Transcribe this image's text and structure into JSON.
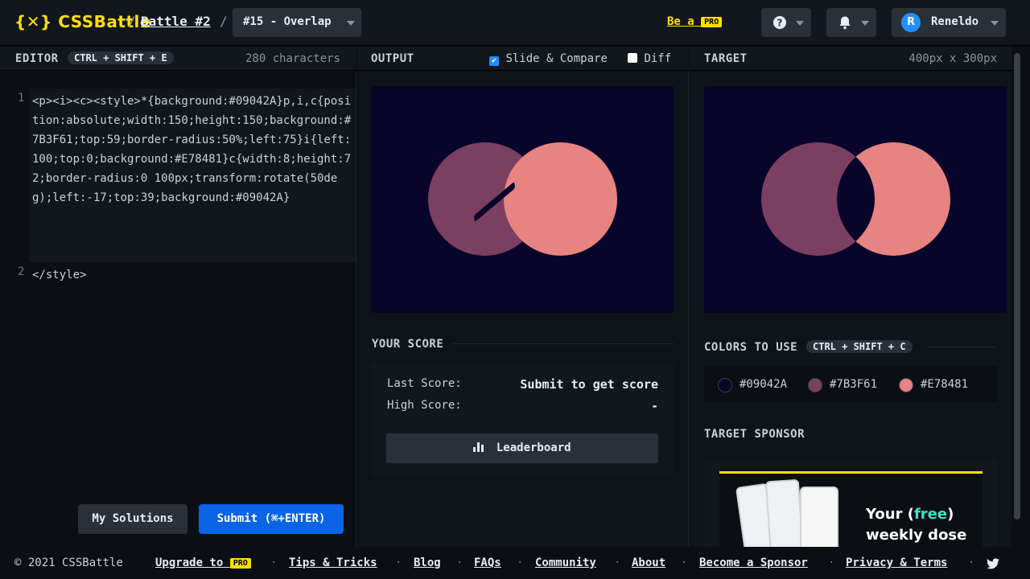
{
  "header": {
    "logo": "{✕} CSSBattle",
    "breadcrumb_battle": "Battle #2",
    "level": "#15 - Overlap",
    "be_a": "Be a",
    "pro": "PRO",
    "user": "Reneldo",
    "avatar_letter": "R",
    "help_icon": "?",
    "bell_icon": "bell-icon"
  },
  "editor": {
    "title": "EDITOR",
    "shortcut": "CTRL + SHIFT + E",
    "char_count": "280 characters",
    "line1": "1",
    "line2": "2",
    "code_line1": "<p><i><c><style>*{background:#09042A}p,i,c{position:absolute;width:150;height:150;background:#7B3F61;top:59;border-radius:50%;left:75}i{left:100;top:0;background:#E78481}c{width:8;height:72;border-radius:0 100px;transform:rotate(50deg);left:-17;top:39;background:#09042A}",
    "code_line2": "</style>",
    "my_solutions": "My Solutions",
    "submit": "Submit (⌘+ENTER)"
  },
  "output": {
    "title": "OUTPUT",
    "slide_compare": "Slide & Compare",
    "slide_checked": true,
    "diff": "Diff",
    "diff_checked": false,
    "your_score": "YOUR SCORE",
    "last_score_label": "Last Score:",
    "last_score_value": "Submit to get score",
    "high_score_label": "High Score:",
    "high_score_value": "-",
    "leaderboard": "Leaderboard"
  },
  "target": {
    "title": "TARGET",
    "size": "400px x 300px",
    "colors_title": "COLORS TO USE",
    "colors_shortcut": "CTRL + SHIFT + C",
    "colors": [
      {
        "hex": "#09042A",
        "label": "#09042A"
      },
      {
        "hex": "#7B3F61",
        "label": "#7B3F61"
      },
      {
        "hex": "#E78481",
        "label": "#E78481"
      }
    ],
    "sponsor_title": "TARGET SPONSOR",
    "ad_line1_a": "Your (",
    "ad_line1_free": "free",
    "ad_line1_b": ")",
    "ad_line2": "weekly dose"
  },
  "footer": {
    "copyright": "© 2021 CSSBattle",
    "links": [
      "Upgrade to",
      "Tips & Tricks",
      "Blog",
      "FAQs",
      "Community",
      "About",
      "Become a Sponsor",
      "Privacy & Terms"
    ],
    "pro": "PRO",
    "twitter_icon": "twitter-icon"
  },
  "colors": {
    "bg": "#09042A",
    "purple": "#7B3F61",
    "pink": "#E78481",
    "accent_yellow": "#ffdf00",
    "submit_blue": "#0b63e5"
  }
}
